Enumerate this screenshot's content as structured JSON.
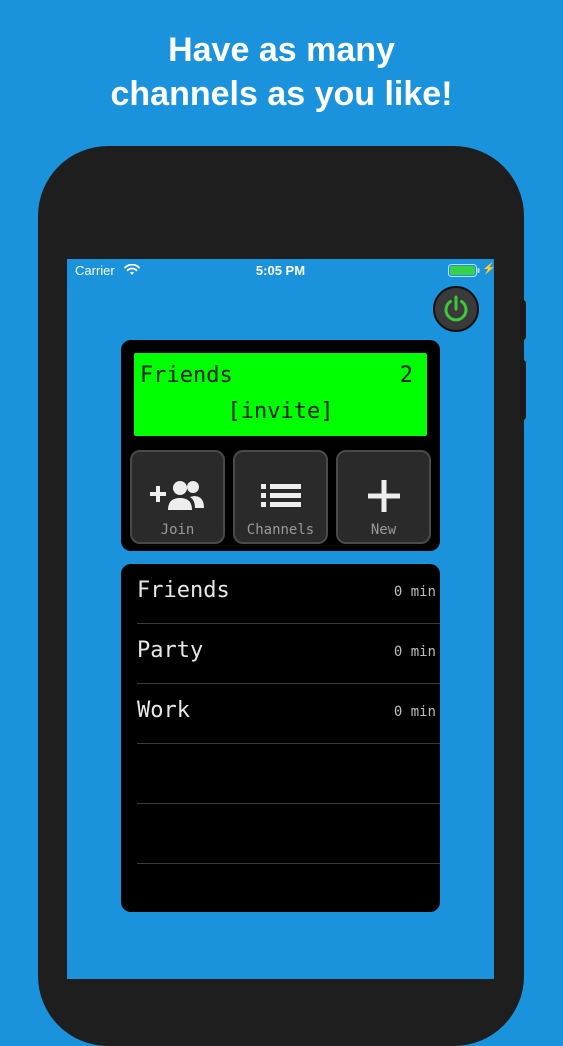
{
  "headline": {
    "line1": "Have as many",
    "line2": "channels as you like!"
  },
  "status_bar": {
    "carrier": "Carrier",
    "time": "5:05 PM",
    "battery_color": "#36d34a"
  },
  "colors": {
    "background": "#1a93dc",
    "lcd": "#00ff00",
    "power_green": "#3ec83e"
  },
  "lcd": {
    "channel_name": "Friends",
    "count": "2",
    "invite": "[invite]"
  },
  "actions": [
    {
      "label": "Join",
      "icon": "add-people-icon"
    },
    {
      "label": "Channels",
      "icon": "list-icon"
    },
    {
      "label": "New",
      "icon": "plus-icon"
    }
  ],
  "channels": [
    {
      "name": "Friends",
      "time": "0 min"
    },
    {
      "name": "Party",
      "time": "0 min"
    },
    {
      "name": "Work",
      "time": "0 min"
    },
    {
      "name": "",
      "time": ""
    },
    {
      "name": "",
      "time": ""
    }
  ]
}
